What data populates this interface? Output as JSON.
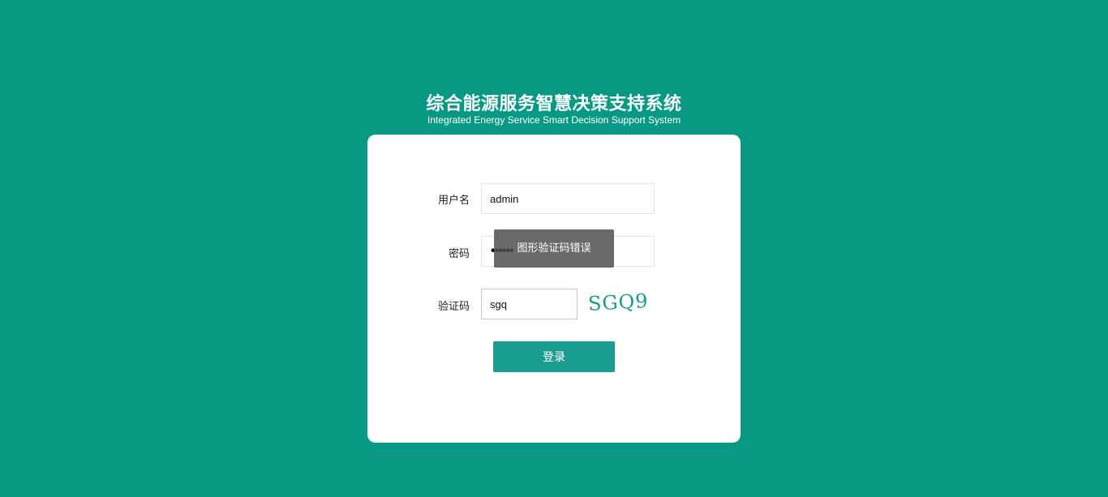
{
  "header": {
    "title_zh": "综合能源服务智慧决策支持系统",
    "title_en": "Integrated Energy Service Smart Decision Support System"
  },
  "form": {
    "username_label": "用户名",
    "username_value": "admin",
    "password_label": "密码",
    "password_mask": "••••••",
    "captcha_label": "验证码",
    "captcha_value": "sgq",
    "captcha_image_text": "SGQ9",
    "login_label": "登录"
  },
  "toast": {
    "message": "图形验证码错误"
  },
  "colors": {
    "background": "#089985",
    "card": "#ffffff",
    "button": "#189d90",
    "captcha_text": "#1a9a8a"
  }
}
